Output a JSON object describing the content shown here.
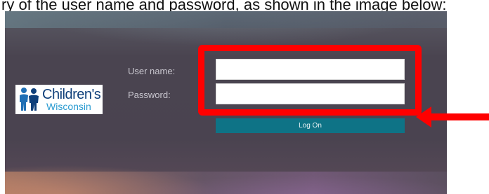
{
  "caption": "ry of the user name and password, as shown in the image below:",
  "logo": {
    "line1": "Children's",
    "line2": "Wisconsin"
  },
  "form": {
    "username_label": "User name:",
    "password_label": "Password:",
    "username_value": "",
    "password_value": "",
    "logon_label": "Log On"
  },
  "colors": {
    "highlight": "#ff0000",
    "button": "#0e7386",
    "logo_navy": "#0f3f7a",
    "logo_blue": "#2a9bd1"
  },
  "icons": {
    "arrow": "left-arrow-icon"
  }
}
